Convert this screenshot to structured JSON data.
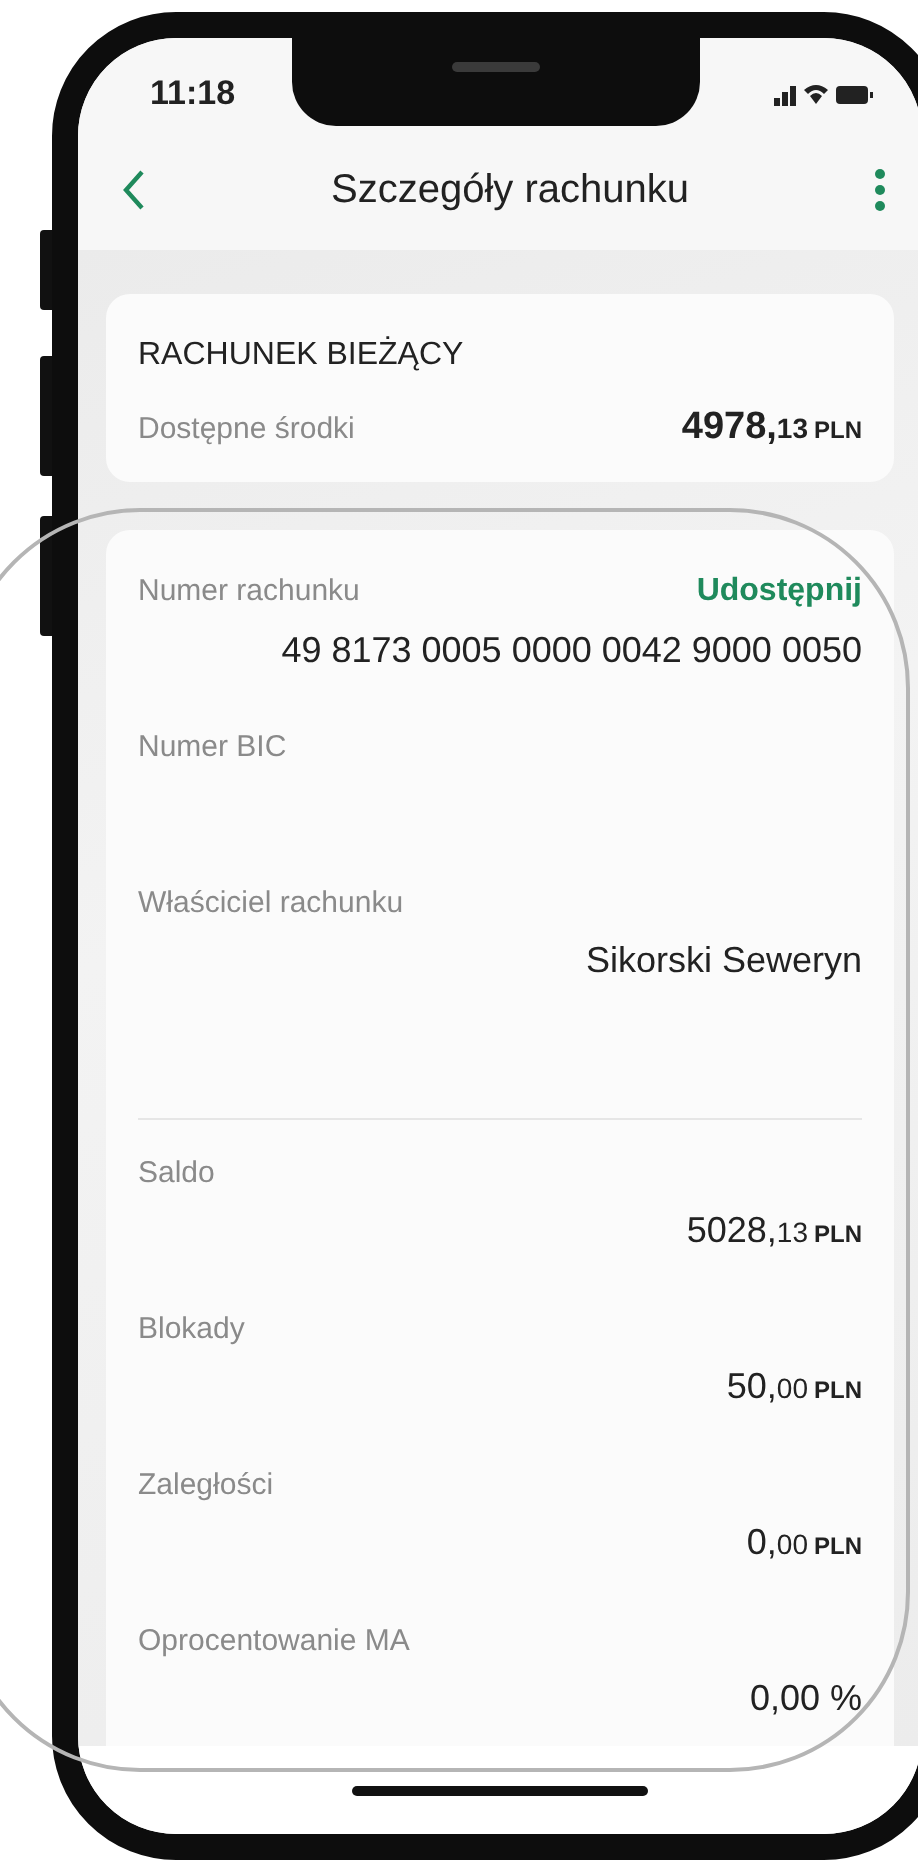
{
  "status_bar": {
    "time": "11:18"
  },
  "header": {
    "title": "Szczegóły rachunku"
  },
  "summary": {
    "title": "RACHUNEK BIEŻĄCY",
    "label": "Dostępne środki",
    "amount": {
      "whole": "4978,",
      "cents": "13",
      "currency": "PLN"
    }
  },
  "details": {
    "groups": [
      [
        {
          "label": "Numer rachunku",
          "action": "Udostępnij",
          "value": "49 8173 0005 0000 0042 9000 0050"
        },
        {
          "label": "Numer BIC"
        },
        {
          "label": "Właściciel rachunku",
          "value": "Sikorski Seweryn"
        }
      ],
      [
        {
          "label": "Saldo",
          "amount": {
            "whole": "5028,",
            "cents": "13",
            "currency": "PLN"
          }
        },
        {
          "label": "Blokady",
          "amount": {
            "whole": "50,",
            "cents": "00",
            "currency": "PLN"
          }
        },
        {
          "label": "Zaległości",
          "amount": {
            "whole": "0,",
            "cents": "00",
            "currency": "PLN"
          }
        },
        {
          "label": "Oprocentowanie MA",
          "value": "0,00 %"
        }
      ]
    ]
  }
}
